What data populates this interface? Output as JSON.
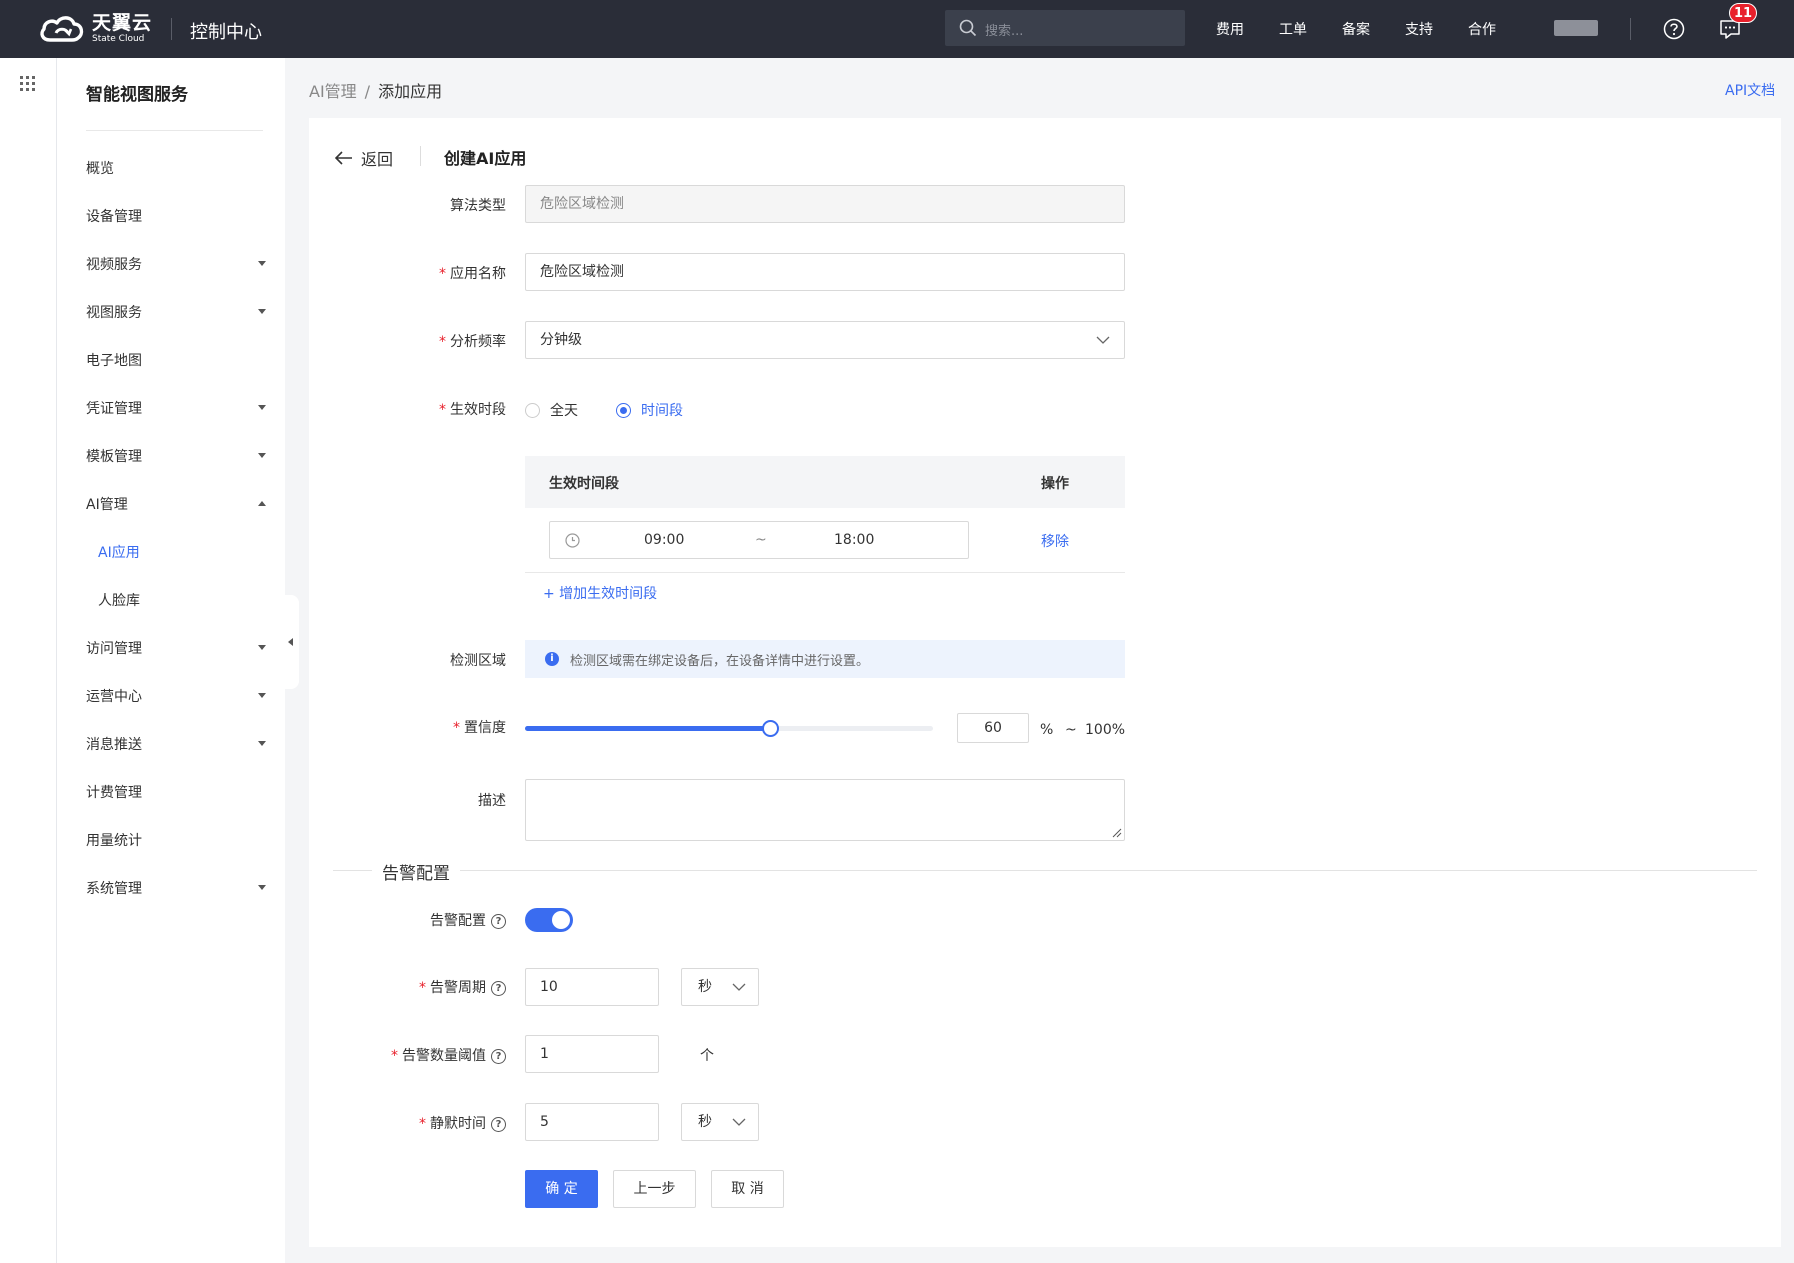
{
  "topbar": {
    "logo_cn": "天翼云",
    "logo_en": "State Cloud",
    "console_title": "控制中心",
    "search_placeholder": "搜索...",
    "nav": [
      "费用",
      "工单",
      "备案",
      "支持",
      "合作"
    ],
    "message_count": "11"
  },
  "sidebar": {
    "title": "智能视图服务",
    "items": [
      {
        "label": "概览"
      },
      {
        "label": "设备管理"
      },
      {
        "label": "视频服务"
      },
      {
        "label": "视图服务"
      },
      {
        "label": "电子地图"
      },
      {
        "label": "凭证管理"
      },
      {
        "label": "模板管理"
      },
      {
        "label": "AI管理"
      },
      {
        "label": "AI应用"
      },
      {
        "label": "人脸库"
      },
      {
        "label": "访问管理"
      },
      {
        "label": "运营中心"
      },
      {
        "label": "消息推送"
      },
      {
        "label": "计费管理"
      },
      {
        "label": "用量统计"
      },
      {
        "label": "系统管理"
      }
    ]
  },
  "breadcrumb": {
    "parent": "AI管理",
    "sep": "/",
    "current": "添加应用"
  },
  "api_doc": "API文档",
  "header": {
    "back": "返回",
    "title": "创建AI应用"
  },
  "form": {
    "algo_type": {
      "label": "算法类型",
      "value": "危险区域检测"
    },
    "app_name": {
      "label": "应用名称",
      "value": "危险区域检测"
    },
    "frequency": {
      "label": "分析频率",
      "value": "分钟级"
    },
    "period": {
      "label": "生效时段",
      "opt_all": "全天",
      "opt_range": "时间段"
    },
    "table": {
      "col_period": "生效时间段",
      "col_action": "操作",
      "start": "09:00",
      "tilde": "~",
      "end": "18:00",
      "remove": "移除",
      "add": "+ 增加生效时间段"
    },
    "area": {
      "label": "检测区域",
      "info": "检测区域需在绑定设备后，在设备详情中进行设置。"
    },
    "confidence": {
      "label": "置信度",
      "value": "60",
      "percent": "%",
      "tilde": "~",
      "max": "100%",
      "fraction": 0.6
    },
    "description": {
      "label": "描述"
    }
  },
  "alarm": {
    "section_title": "告警配置",
    "config_label": "告警配置",
    "cycle_label": "告警周期",
    "cycle_value": "10",
    "cycle_unit": "秒",
    "threshold_label": "告警数量阈值",
    "threshold_value": "1",
    "threshold_unit": "个",
    "silence_label": "静默时间",
    "silence_value": "5",
    "silence_unit": "秒",
    "qmark": "?"
  },
  "buttons": {
    "confirm": "确 定",
    "prev": "上一步",
    "cancel": "取 消"
  },
  "colors": {
    "accent": "#3a6cf0",
    "topbar": "#2a2d38",
    "badge": "#e8202b"
  }
}
